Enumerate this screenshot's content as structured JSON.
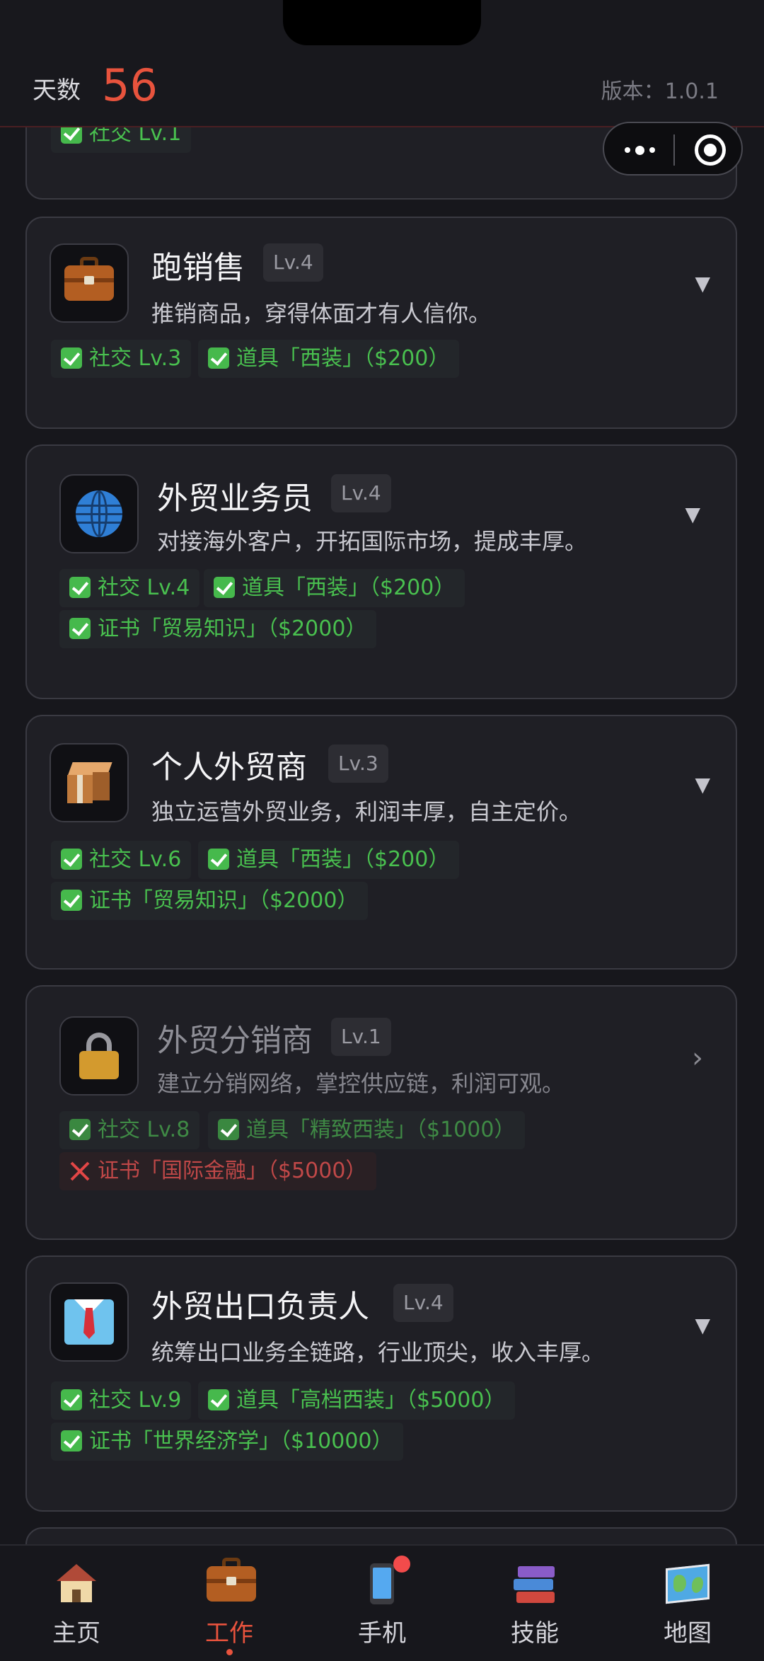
{
  "header": {
    "days_label": "天数",
    "days_value": "56",
    "version": "版本：1.0.1"
  },
  "partial_card": {
    "tag": "社交 Lv.1"
  },
  "jobs": [
    {
      "title": "跑销售",
      "level": "Lv.4",
      "desc": "推销商品，穿得体面才有人信你。",
      "icon": "briefcase-icon",
      "tags": [
        "社交 Lv.3",
        "道具「西装」（$200）"
      ]
    },
    {
      "title": "外贸业务员",
      "level": "Lv.4",
      "desc": "对接海外客户，开拓国际市场，提成丰厚。",
      "icon": "globe-icon",
      "tags": [
        "社交 Lv.4",
        "道具「西装」（$200）",
        "证书「贸易知识」（$2000）"
      ]
    },
    {
      "title": "个人外贸商",
      "level": "Lv.3",
      "desc": "独立运营外贸业务，利润丰厚，自主定价。",
      "icon": "package-icon",
      "tags": [
        "社交 Lv.6",
        "道具「西装」（$200）",
        "证书「贸易知识」（$2000）"
      ]
    },
    {
      "title": "外贸分销商",
      "level": "Lv.1",
      "desc": "建立分销网络，掌控供应链，利润可观。",
      "icon": "lock-icon",
      "tags": [
        "社交 Lv.8",
        "道具「精致西装」（$1000）",
        "证书「国际金融」（$5000）"
      ]
    },
    {
      "title": "外贸出口负责人",
      "level": "Lv.4",
      "desc": "统筹出口业务全链路，行业顶尖，收入丰厚。",
      "icon": "shirt-tie-icon",
      "tags": [
        "社交 Lv.9",
        "道具「高档西装」（$5000）",
        "证书「世界经济学」（$10000）"
      ]
    }
  ],
  "nav": [
    {
      "label": "主页",
      "icon": "house-icon"
    },
    {
      "label": "工作",
      "icon": "briefcase-icon",
      "active": true
    },
    {
      "label": "手机",
      "icon": "phone-icon",
      "badge": true
    },
    {
      "label": "技能",
      "icon": "books-icon"
    },
    {
      "label": "地图",
      "icon": "map-icon"
    }
  ],
  "colors": {
    "accent": "#e8533d",
    "ok": "#49c04f",
    "fail": "#e45050",
    "background": "#17171c",
    "card": "#1f1f25"
  }
}
